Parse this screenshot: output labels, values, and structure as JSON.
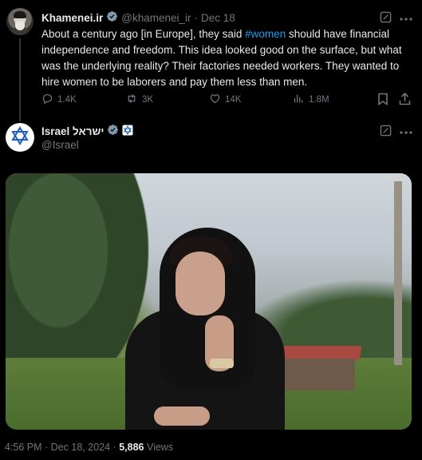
{
  "tweet": {
    "author_name": "Khamenei.ir",
    "author_handle": "@khamenei_ir",
    "separator": "·",
    "date": "Dec 18",
    "text_before": "About a century ago [in Europe], they said ",
    "hashtag": "#women",
    "text_after": " should have financial independence and freedom. This idea looked good on the surface, but what was the underlying reality? Their factories needed workers. They wanted to hire women to be laborers and pay them less than men.",
    "replies": "1.4K",
    "reposts": "3K",
    "likes": "14K",
    "views": "1.8M"
  },
  "reply": {
    "author_name": "Israel ישראל",
    "author_handle": "@Israel"
  },
  "footer": {
    "time": "4:56 PM",
    "separator1": "·",
    "date": "Dec 18, 2024",
    "separator2": "·",
    "views_count": "5,886",
    "views_label": "Views"
  },
  "colors": {
    "background": "#000000",
    "text": "#e7e9ea",
    "muted": "#71767b",
    "link": "#1d9bf0",
    "verified": "#829aab"
  }
}
